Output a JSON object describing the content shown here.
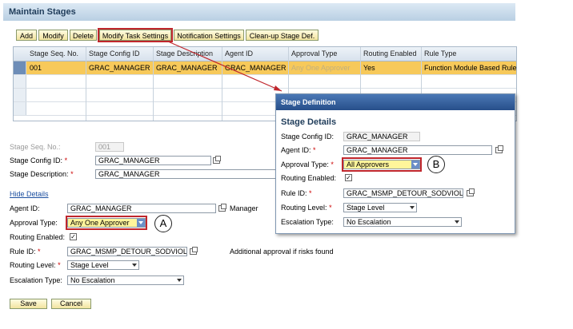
{
  "page_title": "Maintain Stages",
  "toolbar": {
    "add": "Add",
    "modify": "Modify",
    "delete": "Delete",
    "modify_task_settings": "Modify Task Settings",
    "notification_settings": "Notification Settings",
    "cleanup_stage_def": "Clean-up Stage Def."
  },
  "table": {
    "columns": [
      "Stage Seq. No.",
      "Stage Config ID",
      "Stage Description",
      "Agent ID",
      "Approval Type",
      "Routing Enabled",
      "Rule Type"
    ],
    "rows": [
      [
        "001",
        "GRAC_MANAGER",
        "GRAC_MANAGER",
        "GRAC_MANAGER",
        "Any One Approver",
        "Yes",
        "Function Module Based Rule"
      ]
    ]
  },
  "form": {
    "stage_seq_label": "Stage Seq. No.:",
    "stage_seq_value": "001",
    "stage_config_label": "Stage Config ID:",
    "stage_config_value": "GRAC_MANAGER",
    "stage_desc_label": "Stage Description:",
    "stage_desc_value": "GRAC_MANAGER",
    "hide_details": "Hide Details",
    "agent_label": "Agent ID:",
    "agent_value": "GRAC_MANAGER",
    "agent_desc": "Manager",
    "approval_label": "Approval Type:",
    "approval_value": "Any One Approver",
    "routing_label": "Routing Enabled:",
    "routing_checked": "✓",
    "rule_label": "Rule ID:",
    "rule_value": "GRAC_MSMP_DETOUR_SODVIOL",
    "rule_desc": "Additional approval if risks found",
    "routing_level_label": "Routing Level:",
    "routing_level_value": "Stage Level",
    "escalation_label": "Escalation Type:",
    "escalation_value": "No Escalation",
    "required_mark": "*",
    "save": "Save",
    "cancel": "Cancel"
  },
  "popup": {
    "title": "Stage Definition",
    "section": "Stage Details",
    "config_label": "Stage Config ID:",
    "config_value": "GRAC_MANAGER",
    "agent_label": "Agent ID:",
    "agent_value": "GRAC_MANAGER",
    "approval_label": "Approval Type:",
    "approval_value": "All Approvers",
    "routing_label": "Routing Enabled:",
    "routing_checked": "✓",
    "rule_label": "Rule ID:",
    "rule_value": "GRAC_MSMP_DETOUR_SODVIOL",
    "routing_level_label": "Routing Level:",
    "routing_level_value": "Stage Level",
    "escalation_label": "Escalation Type:",
    "escalation_value": "No Escalation"
  },
  "callouts": {
    "a": "A",
    "b": "B"
  },
  "colors": {
    "header": "#b9cfe3",
    "selected_row": "#f7c95a",
    "highlight_box": "#c0262c",
    "popup_header": "#274f8a"
  }
}
